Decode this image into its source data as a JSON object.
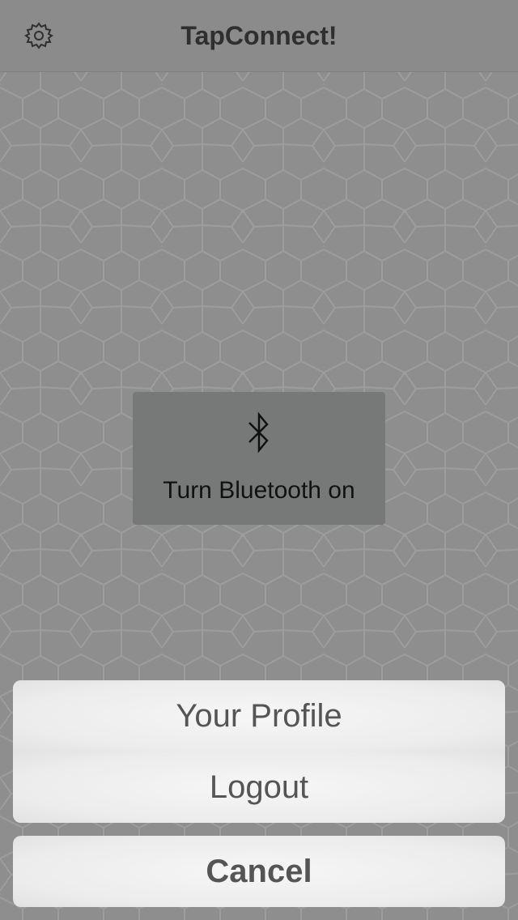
{
  "app": {
    "title": "TapConnect!"
  },
  "navbar": {
    "settings_icon": "gear-icon"
  },
  "bluetooth_prompt": {
    "icon": "bluetooth-icon",
    "label": "Turn Bluetooth on"
  },
  "action_sheet": {
    "items": [
      {
        "label": "Your Profile"
      },
      {
        "label": "Logout"
      }
    ],
    "cancel_label": "Cancel"
  },
  "colors": {
    "background": "#8e8e8e",
    "navbar": "#8b8b8b",
    "bluetooth_box": "#777979",
    "sheet_button": "#efefef",
    "sheet_text": "#555555"
  }
}
